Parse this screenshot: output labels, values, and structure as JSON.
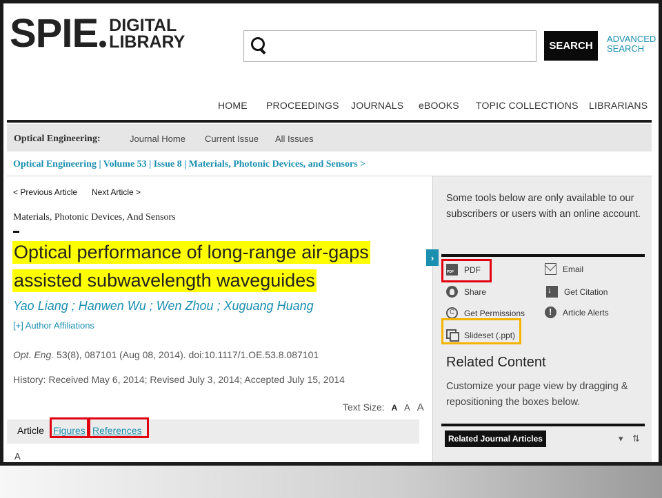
{
  "logo": {
    "brand": "SPIE",
    "line1": "DIGITAL",
    "line2": "LIBRARY"
  },
  "search": {
    "value": "",
    "placeholder": "",
    "button_label": "SEARCH",
    "advanced_label": "ADVANCED SEARCH"
  },
  "nav": [
    "HOME",
    "PROCEEDINGS",
    "JOURNALS",
    "eBOOKS",
    "TOPIC COLLECTIONS",
    "LIBRARIANS"
  ],
  "journal_bar": {
    "title": "Optical Engineering:",
    "links": [
      "Journal Home",
      "Current Issue",
      "All Issues"
    ]
  },
  "breadcrumb": "Optical Engineering | Volume 53 | Issue 8 | Materials, Photonic Devices, and Sensors >",
  "article": {
    "prev_label": "< Previous Article",
    "next_label": "Next Article >",
    "section": "Materials, Photonic Devices, And Sensors",
    "title_line1": "Optical performance of long-range air-gaps",
    "title_line2": "assisted subwavelength waveguides",
    "authors": "Yao Liang ; Hanwen Wu ; Wen Zhou ; Xuguang Huang",
    "affiliations": "[+] Author Affiliations",
    "citation_journal": "Opt. Eng.",
    "citation_rest": " 53(8), 087101 (Aug 08, 2014). doi:10.1117/1.OE.53.8.087101",
    "history": "History: Received May 6, 2014; Revised July 3, 2014; Accepted July 15, 2014",
    "text_size_label": "Text Size:",
    "text_size_options": [
      "A",
      "A",
      "A"
    ],
    "tabs": [
      "Article",
      "Figures",
      "References"
    ],
    "body_start": "A"
  },
  "tools": {
    "note": "Some tools below are only available to our subscribers or users with an online account.",
    "expand_glyph": "›",
    "items": [
      "PDF",
      "Email",
      "Share",
      "Get Citation",
      "Get Permissions",
      "Article Alerts",
      "Slideset (.ppt)"
    ]
  },
  "related": {
    "title": "Related Content",
    "description": "Customize your page view by dragging & repositioning the boxes below.",
    "journal_articles_label": "Related Journal Articles",
    "collapse_glyph": "▾",
    "sort_glyph": "⇅"
  },
  "colors": {
    "accent": "#1a8fb0",
    "highlight": "#ffff00",
    "callout_red": "#e10010",
    "callout_orange": "#f4b400"
  },
  "icons": [
    "search-icon",
    "pdf-icon",
    "email-icon",
    "share-icon",
    "citation-icon",
    "permissions-icon",
    "alert-icon",
    "slideset-icon"
  ]
}
